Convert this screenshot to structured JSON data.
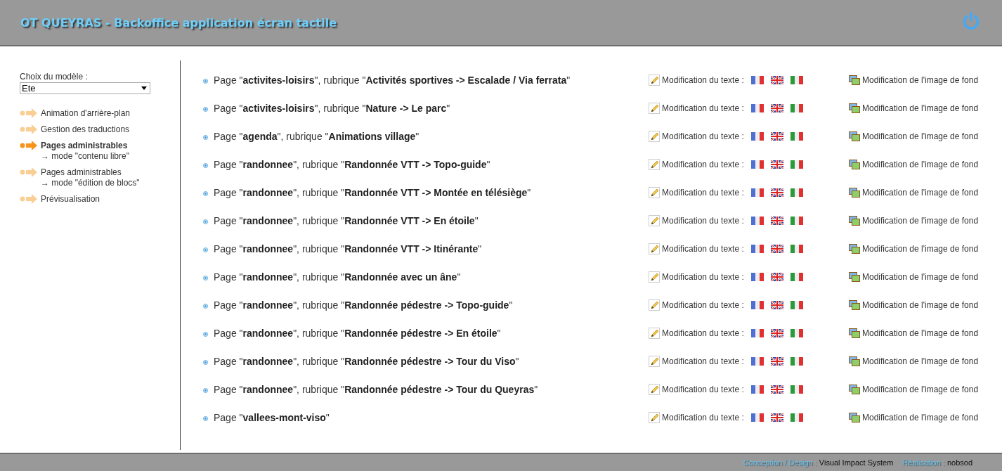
{
  "header": {
    "title": "OT QUEYRAS - Backoffice application écran tactile"
  },
  "sidebar": {
    "model_label": "Choix du modèle :",
    "model_select": {
      "value": "Ete"
    },
    "items": [
      {
        "label": "Animation d'arrière-plan",
        "selected": false
      },
      {
        "label": "Gestion des traductions",
        "selected": false
      },
      {
        "label": "Pages administrables",
        "sublabel": "→ mode \"contenu libre\"",
        "selected": true
      },
      {
        "label": "Pages administrables",
        "sublabel": "→ mode \"édition de blocs\"",
        "selected": false
      },
      {
        "label": "Prévisualisation",
        "selected": false
      }
    ]
  },
  "pages": [
    {
      "title": "Page \"**activites-loisirs**\", rubrique \"**Activités sportives -> Escalade / Via ferrata**\"",
      "text_label": "Modification du texte :",
      "image_link": "Modification de l'image de fond"
    },
    {
      "title": "Page \"**activites-loisirs**\", rubrique \"**Nature -> Le parc**\"",
      "text_label": "Modification du texte :",
      "image_link": "Modification de l'image de fond"
    },
    {
      "title": "Page \"**agenda**\", rubrique \"**Animations village**\"",
      "text_label": "Modification du texte :",
      "image_link": "Modification de l'image de fond"
    },
    {
      "title": "Page \"**randonnee**\", rubrique \"**Randonnée VTT -> Topo-guide**\"",
      "text_label": "Modification du texte :",
      "image_link": "Modification de l'image de fond"
    },
    {
      "title": "Page \"**randonnee**\", rubrique \"**Randonnée VTT -> Montée en télésiège**\"",
      "text_label": "Modification du texte :",
      "image_link": "Modification de l'image de fond"
    },
    {
      "title": "Page \"**randonnee**\", rubrique \"**Randonnée VTT -> En étoile**\"",
      "text_label": "Modification du texte :",
      "image_link": "Modification de l'image de fond"
    },
    {
      "title": "Page \"**randonnee**\", rubrique \"**Randonnée VTT -> Itinérante**\"",
      "text_label": "Modification du texte :",
      "image_link": "Modification de l'image de fond"
    },
    {
      "title": "Page \"**randonnee**\", rubrique \"**Randonnée avec un âne**\"",
      "text_label": "Modification du texte :",
      "image_link": "Modification de l'image de fond"
    },
    {
      "title": "Page \"**randonnee**\", rubrique \"**Randonnée pédestre -> Topo-guide**\"",
      "text_label": "Modification du texte :",
      "image_link": "Modification de l'image de fond"
    },
    {
      "title": "Page \"**randonnee**\", rubrique \"**Randonnée pédestre -> En étoile**\"",
      "text_label": "Modification du texte :",
      "image_link": "Modification de l'image de fond"
    },
    {
      "title": "Page \"**randonnee**\", rubrique \"**Randonnée pédestre -> Tour du Viso**\"",
      "text_label": "Modification du texte :",
      "image_link": "Modification de l'image de fond"
    },
    {
      "title": "Page \"**randonnee**\", rubrique \"**Randonnée pédestre -> Tour du Queyras**\"",
      "text_label": "Modification du texte :",
      "image_link": "Modification de l'image de fond"
    },
    {
      "title": "Page \"**vallees-mont-viso**\"",
      "text_label": "Modification du texte :",
      "image_link": "Modification de l'image de fond"
    }
  ],
  "footer": {
    "design_label": "Conception / Design :",
    "design_value": "Visual Impact System",
    "dev_label": "Réalisation :",
    "dev_value": "nobsod"
  }
}
